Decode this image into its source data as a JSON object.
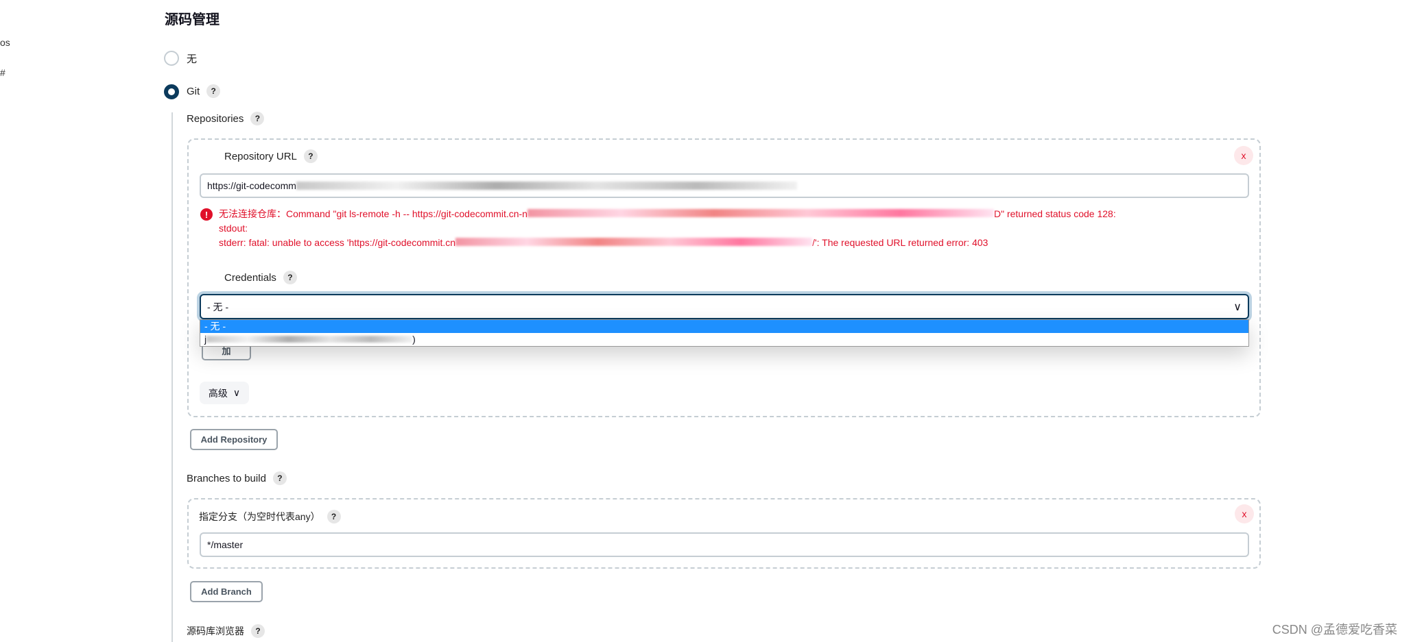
{
  "sidebar": {
    "fragments": [
      "os",
      "#"
    ]
  },
  "section_title": "源码管理",
  "scm": {
    "options": [
      {
        "label": "无",
        "selected": false
      },
      {
        "label": "Git",
        "selected": true
      }
    ],
    "help_icon": "?",
    "repositories_label": "Repositories",
    "repository": {
      "url_label": "Repository URL",
      "url_value_visible": "https://git-codecomm",
      "error": {
        "line1_prefix": "无法连接仓库：Command \"git ls-remote -h -- https://git-codecommit.cn-n",
        "line1_suffix": "D\" returned status code 128:",
        "line2": "stdout:",
        "line3_prefix": "stderr: fatal: unable to access 'https://git-codecommit.cn",
        "line3_suffix": "/': The requested URL returned error: 403"
      },
      "credentials_label": "Credentials",
      "credentials_selected": "- 无 -",
      "credentials_options": [
        "- 无 -",
        "j"
      ],
      "credentials_option2_suffix": ")",
      "add_label": "加",
      "advanced_label": "高级",
      "delete_label": "x"
    },
    "add_repository_label": "Add Repository",
    "branches_label": "Branches to build",
    "branch": {
      "label": "指定分支（为空时代表any）",
      "value": "*/master",
      "delete_label": "x"
    },
    "add_branch_label": "Add Branch",
    "browser_label": "源码库浏览器"
  },
  "watermark": "CSDN @孟德爱吃香菜",
  "colors": {
    "accent": "#0b3a5c",
    "error": "#e0102a",
    "selected_option": "#1e90ff"
  }
}
